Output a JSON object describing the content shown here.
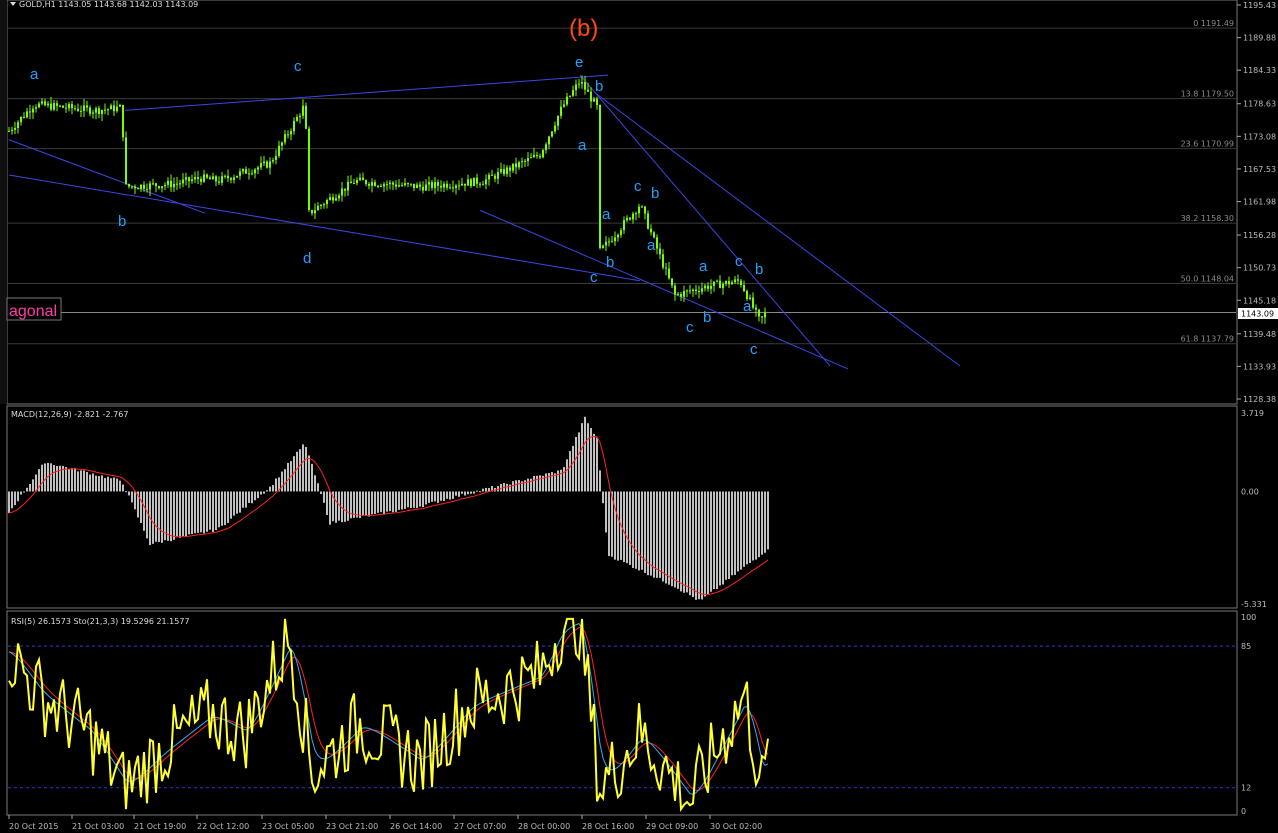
{
  "header": {
    "symbol_text": "GOLD,H1  1143.05 1143.68 1142.03 1143.09"
  },
  "colors": {
    "background": "#000000",
    "candle": "#7cfc00",
    "trendline": "#3c46e6",
    "wave_label": "#1fa3ff",
    "big_label": "#ff4a0c",
    "macd_hist": "#c0c0c0",
    "macd_signal": "#ff2020",
    "rsi": "#ffff33",
    "sto_main": "#33aaff",
    "sto_signal": "#ff2020",
    "level_line": "#2a3ad0",
    "side_label": "#ff3aa8"
  },
  "side_label": "agonal",
  "current_price_tag": "1143.09",
  "price_axis": {
    "ticks": [
      "1195.43",
      "1189.88",
      "1184.33",
      "1178.63",
      "1173.08",
      "1167.53",
      "1161.98",
      "1156.28",
      "1150.73",
      "1145.18",
      "1139.48",
      "1133.93",
      "1128.38"
    ]
  },
  "fib_levels": [
    {
      "label": "0 1191.49",
      "price": 1191.49
    },
    {
      "label": "13.8 1179.50",
      "price": 1179.5
    },
    {
      "label": "23.6 1170.99",
      "price": 1170.99
    },
    {
      "label": "38.2 1158.30",
      "price": 1158.3
    },
    {
      "label": "50.0 1148.04",
      "price": 1148.04
    },
    {
      "label": "61.8 1137.79",
      "price": 1137.79
    }
  ],
  "wave_labels": [
    {
      "text": "(b)",
      "big": true
    },
    {
      "text": "a"
    },
    {
      "text": "b"
    },
    {
      "text": "c"
    },
    {
      "text": "d"
    },
    {
      "text": "e"
    },
    {
      "text": "b"
    },
    {
      "text": "a"
    },
    {
      "text": "a"
    },
    {
      "text": "b"
    },
    {
      "text": "c"
    },
    {
      "text": "c"
    },
    {
      "text": "b"
    },
    {
      "text": "a"
    },
    {
      "text": "a"
    },
    {
      "text": "c"
    },
    {
      "text": "b"
    },
    {
      "text": "c"
    },
    {
      "text": "b"
    },
    {
      "text": "a"
    },
    {
      "text": "c"
    }
  ],
  "macd": {
    "legend": "MACD(12,26,9) -2.821 -2.767",
    "axis": [
      "3.719",
      "0.00",
      "-5.331"
    ]
  },
  "rsi_sto": {
    "legend": "RSI(5) 26.1573  Sto(21,3,3) 19.5296 21.1577",
    "axis": [
      "100",
      "85",
      "12",
      "0"
    ]
  },
  "time_axis": [
    "20 Oct 2015",
    "21 Oct 03:00",
    "21 Oct 19:00",
    "22 Oct 12:00",
    "23 Oct 05:00",
    "23 Oct 21:00",
    "26 Oct 14:00",
    "27 Oct 07:00",
    "28 Oct 00:00",
    "28 Oct 16:00",
    "29 Oct 09:00",
    "30 Oct 02:00"
  ],
  "chart_data": [
    {
      "type": "candlestick",
      "title": "GOLD,H1",
      "ohlc_last": {
        "open": 1143.05,
        "high": 1143.68,
        "low": 1142.03,
        "close": 1143.09
      },
      "ylim": [
        1128.38,
        1195.43
      ],
      "close_path": [
        {
          "x": "20 Oct 2015",
          "y": 1174.0
        },
        {
          "x": "20 Oct 08:00",
          "y": 1178.5
        },
        {
          "x": "20 Oct 18:00",
          "y": 1177.5
        },
        {
          "x": "21 Oct 03:00",
          "y": 1178.0
        },
        {
          "x": "21 Oct 04:00",
          "y": 1164.5
        },
        {
          "x": "21 Oct 19:00",
          "y": 1165.0
        },
        {
          "x": "22 Oct 06:00",
          "y": 1166.0
        },
        {
          "x": "22 Oct 12:00",
          "y": 1165.5
        },
        {
          "x": "23 Oct 00:00",
          "y": 1168.5
        },
        {
          "x": "23 Oct 05:00",
          "y": 1178.5
        },
        {
          "x": "23 Oct 06:00",
          "y": 1160.0
        },
        {
          "x": "23 Oct 21:00",
          "y": 1165.5
        },
        {
          "x": "26 Oct 14:00",
          "y": 1164.5
        },
        {
          "x": "27 Oct 07:00",
          "y": 1165.5
        },
        {
          "x": "27 Oct 20:00",
          "y": 1170.0
        },
        {
          "x": "28 Oct 00:00",
          "y": 1178.0
        },
        {
          "x": "28 Oct 03:00",
          "y": 1182.5
        },
        {
          "x": "28 Oct 09:00",
          "y": 1178.0
        },
        {
          "x": "28 Oct 10:00",
          "y": 1153.5
        },
        {
          "x": "28 Oct 16:00",
          "y": 1156.0
        },
        {
          "x": "29 Oct 00:00",
          "y": 1161.5
        },
        {
          "x": "29 Oct 09:00",
          "y": 1146.0
        },
        {
          "x": "29 Oct 20:00",
          "y": 1147.5
        },
        {
          "x": "30 Oct 02:00",
          "y": 1148.5
        },
        {
          "x": "30 Oct 04:00",
          "y": 1141.5
        },
        {
          "x": "30 Oct 05:00",
          "y": 1143.09
        }
      ]
    },
    {
      "type": "bar",
      "title": "MACD(12,26,9)",
      "series": [
        {
          "name": "MACD",
          "last": -2.821
        },
        {
          "name": "Signal",
          "last": -2.767
        }
      ],
      "ylim": [
        -5.331,
        3.719
      ],
      "profile": [
        {
          "x": "20 Oct 2015",
          "y": -1.0
        },
        {
          "x": "20 Oct 12:00",
          "y": 1.4
        },
        {
          "x": "21 Oct 03:00",
          "y": 0.5
        },
        {
          "x": "21 Oct 12:00",
          "y": -2.5
        },
        {
          "x": "22 Oct 12:00",
          "y": -1.8
        },
        {
          "x": "23 Oct 00:00",
          "y": 0.2
        },
        {
          "x": "23 Oct 05:00",
          "y": 2.3
        },
        {
          "x": "23 Oct 10:00",
          "y": -1.5
        },
        {
          "x": "26 Oct 14:00",
          "y": -0.7
        },
        {
          "x": "27 Oct 07:00",
          "y": 0.1
        },
        {
          "x": "28 Oct 00:00",
          "y": 1.0
        },
        {
          "x": "28 Oct 04:00",
          "y": 3.5
        },
        {
          "x": "28 Oct 09:00",
          "y": 2.5
        },
        {
          "x": "28 Oct 12:00",
          "y": -3.0
        },
        {
          "x": "29 Oct 09:00",
          "y": -4.5
        },
        {
          "x": "29 Oct 18:00",
          "y": -5.2
        },
        {
          "x": "30 Oct 05:00",
          "y": -2.8
        }
      ]
    },
    {
      "type": "line",
      "title": "RSI(5) / Sto(21,3,3)",
      "series": [
        {
          "name": "RSI(5)",
          "last": 26.1573
        },
        {
          "name": "Sto main",
          "last": 19.5296
        },
        {
          "name": "Sto signal",
          "last": 21.1577
        }
      ],
      "ylim": [
        0,
        100
      ],
      "levels": [
        85,
        12
      ]
    }
  ]
}
